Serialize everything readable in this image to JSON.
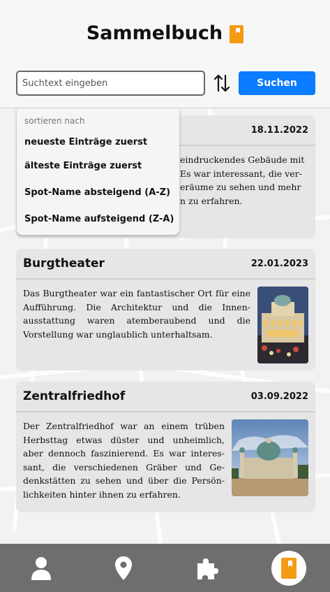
{
  "header": {
    "title": "Sammelbuch",
    "title_icon": "book-icon"
  },
  "search": {
    "placeholder": "Suchtext eingeben",
    "value": "",
    "sort_icon": "sort-arrows-icon",
    "button_label": "Suchen"
  },
  "sort_menu": {
    "label": "sortieren nach",
    "options": [
      "neueste Einträge zuerst",
      "älteste Einträge zuerst",
      "Spot-Name absteigend (A-Z)",
      "Spot-Name aufsteigend (Z-A)"
    ]
  },
  "entries": [
    {
      "title": "",
      "date": "18.11.2022",
      "text_lines": [
        "eindruckendes Gebäude mit",
        "Es war interessant, die ver-",
        "eräume zu sehen und mehr",
        "n zu erfahren."
      ]
    },
    {
      "title": "Burgtheater",
      "date": "22.01.2023",
      "text": "Das Burgtheater war ein fantastischer Ort für eine Aufführung. Die Architektur und die Innen­ausstattung waren atemberaubend und die Vorstellung war unglaublich unterhaltsam."
    },
    {
      "title": "Zentralfriedhof",
      "date": "03.09.2022",
      "text": "Der Zentralfriedhof war an einem trüben Herbsttag etwas düster und unheimlich, aber dennoch faszinierend. Es war interes­sant, die verschiedenen Gräber und Ge­denkstätten zu sehen und über die Persön­lichkeiten hinter ihnen zu erfahren."
    }
  ],
  "nav": {
    "items": [
      "person-icon",
      "location-pin-icon",
      "puzzle-icon",
      "book-icon"
    ],
    "active": "book-icon"
  },
  "colors": {
    "accent_blue": "#0a7cff",
    "book_orange": "#f39c12",
    "nav_bg": "#6e6e6e",
    "card_bg": "#e6e6e6"
  }
}
